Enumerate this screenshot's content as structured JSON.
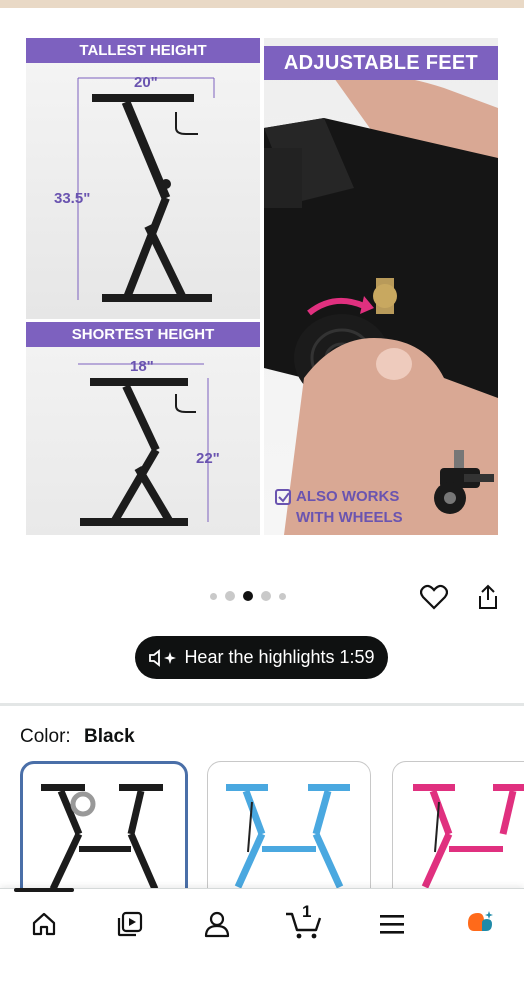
{
  "hero": {
    "left_top_title": "TALLEST HEIGHT",
    "left_top_width": "20\"",
    "left_top_height": "33.5\"",
    "left_bottom_title": "SHORTEST HEIGHT",
    "left_bottom_width": "18\"",
    "left_bottom_height": "22\"",
    "right_title": "ADJUSTABLE FEET",
    "wheels_line1": "ALSO WORKS",
    "wheels_line2": "WITH WHEELS"
  },
  "carousel": {
    "dots": 5,
    "active_index": 2
  },
  "actions": {
    "favorite_icon": "heart-icon",
    "share_icon": "share-icon"
  },
  "audio": {
    "label": "Hear the highlights 1:59"
  },
  "color": {
    "label": "Color:",
    "value": "Black"
  },
  "swatches": [
    {
      "name": "Black",
      "color": "#1c1c1c",
      "selected": true
    },
    {
      "name": "Blue",
      "color": "#4aa8e0",
      "selected": false
    },
    {
      "name": "Pink",
      "color": "#e0307f",
      "selected": false
    }
  ],
  "tabbar": {
    "items": [
      "home-icon",
      "video-icon",
      "account-icon",
      "cart-icon",
      "menu-icon",
      "rufus-icon"
    ],
    "cart_count": "1"
  }
}
